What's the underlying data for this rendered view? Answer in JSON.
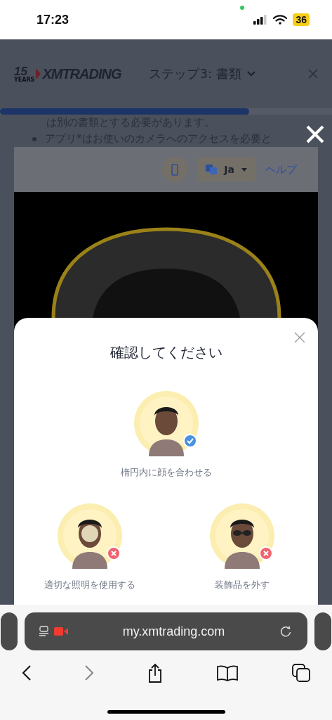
{
  "status_bar": {
    "time": "17:23",
    "battery": "36"
  },
  "header": {
    "logo": {
      "years_number": "15",
      "years_label": "YEARS",
      "brand": "XMTRADING"
    },
    "step_title": "ステップ3: 書類"
  },
  "progress": {
    "level": 0.75
  },
  "page_text": {
    "continuation": "は別の書類とする必要があります。",
    "bullets": [
      "アプリ*はお使いのカメラへのアクセスを必要と"
    ]
  },
  "toolbar": {
    "language": "Ja",
    "help": "ヘルプ"
  },
  "modal": {
    "title": "確認してください",
    "tips": [
      {
        "label": "楕円内に顔を合わせる",
        "approved": true,
        "kind": "plain"
      },
      {
        "label": "適切な照明を使用する",
        "approved": false,
        "kind": "glare"
      },
      {
        "label": "装飾品を外す",
        "approved": false,
        "kind": "sunglasses"
      }
    ]
  },
  "browser": {
    "url": "my.xmtrading.com"
  }
}
